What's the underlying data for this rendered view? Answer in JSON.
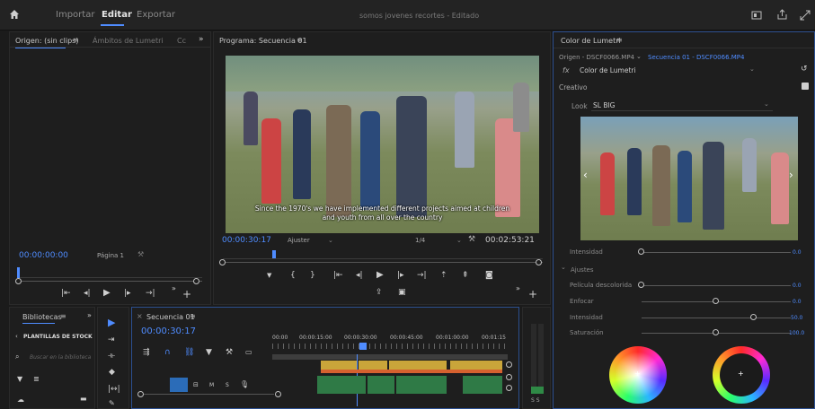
{
  "topbar": {
    "tabs": [
      "Importar",
      "Editar",
      "Exportar"
    ],
    "project_title": "somos jovenes recortes - Editado"
  },
  "source_panel": {
    "tab_source": "Origen: (sin clips)",
    "tab_lumetri_scopes": "Ámbitos de Lumetri",
    "tab_more": "Cc",
    "timecode": "00:00:00:00",
    "page_label": "Página 1"
  },
  "program_panel": {
    "title": "Programa: Secuencia 01",
    "subtitle_line1": "Since the 1970's we have implemented different projects aimed at children",
    "subtitle_line2": "and youth from all over the country",
    "timecode": "00:00:30:17",
    "fit": "Ajuster",
    "resolution": "1/4",
    "duration": "00:02:53:21"
  },
  "lumetri": {
    "title": "Color de Lumetri",
    "breadcrumb_source": "Origen - DSCF0066.MP4",
    "breadcrumb_seq": "Secuencia 01 - DSCF0066.MP4",
    "fx_label": "fx",
    "effect_name": "Color de Lumetri",
    "section_creative": "Creativo",
    "look_label": "Look",
    "look_value": "SL BIG",
    "intensity_label": "Intensidad",
    "intensity_value": "0.0",
    "adjustments_label": "Ajustes",
    "sliders": [
      {
        "label": "Película descolorida",
        "value": "0.0"
      },
      {
        "label": "Enfocar",
        "value": "0.0"
      },
      {
        "label": "Intensidad",
        "value": "50.0"
      },
      {
        "label": "Saturación",
        "value": "100.0"
      }
    ]
  },
  "libraries": {
    "title": "Bibliotecas",
    "section": "PLANTILLAS DE STOCK",
    "search_placeholder": "Buscar en la biblioteca"
  },
  "timeline": {
    "title": "Secuencia 01",
    "timecode": "00:00:30:17",
    "ruler": [
      "00:00",
      "00:00:15:00",
      "00:00:30:00",
      "00:00:45:00",
      "00:01:00:00",
      "00:01:15"
    ]
  },
  "audio_meter": {
    "label": "S S"
  }
}
